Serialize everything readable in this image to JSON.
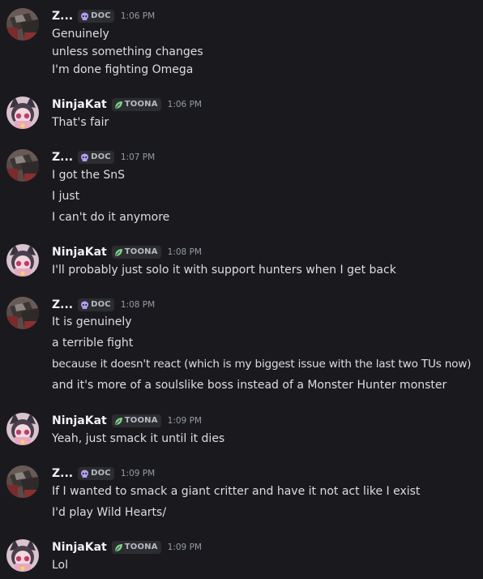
{
  "colors": {
    "background": "#1a1a1e",
    "username": "#f2f3f5",
    "message_text": "#dbdee1",
    "timestamp": "#949ba4",
    "tag_background": "#2b2d31",
    "doc_icon": "#b79cf5",
    "toona_icon": "#7fd18a"
  },
  "messages": [
    {
      "user": "Z...",
      "tag": "DOC",
      "tag_icon": "skull-icon",
      "time": "1:06 PM",
      "lines": [
        "Genuinely",
        "unless something changes",
        "I'm done fighting Omega"
      ]
    },
    {
      "user": "NinjaKat",
      "tag": "TOONA",
      "tag_icon": "leaf-icon",
      "time": "1:06 PM",
      "lines": [
        "That's fair"
      ]
    },
    {
      "user": "Z...",
      "tag": "DOC",
      "tag_icon": "skull-icon",
      "time": "1:07 PM",
      "lines": [
        "I got the SnS",
        "I just",
        "I can't do it anymore"
      ]
    },
    {
      "user": "NinjaKat",
      "tag": "TOONA",
      "tag_icon": "leaf-icon",
      "time": "1:08 PM",
      "lines": [
        "I'll probably just solo it with support hunters when I get back"
      ]
    },
    {
      "user": "Z...",
      "tag": "DOC",
      "tag_icon": "skull-icon",
      "time": "1:08 PM",
      "lines": [
        "It is genuinely",
        "a terrible fight",
        "because it doesn't react (which is my biggest issue with the last two TUs now)",
        "and it's more of a soulslike boss instead of a Monster Hunter monster"
      ]
    },
    {
      "user": "NinjaKat",
      "tag": "TOONA",
      "tag_icon": "leaf-icon",
      "time": "1:09 PM",
      "lines": [
        "Yeah, just smack it until it dies"
      ]
    },
    {
      "user": "Z...",
      "tag": "DOC",
      "tag_icon": "skull-icon",
      "time": "1:09 PM",
      "lines": [
        "If I wanted to smack a giant critter and have it not act like I exist",
        "I'd play Wild Hearts/"
      ]
    },
    {
      "user": "NinjaKat",
      "tag": "TOONA",
      "tag_icon": "leaf-icon",
      "time": "1:09 PM",
      "lines": [
        "Lol"
      ]
    }
  ]
}
